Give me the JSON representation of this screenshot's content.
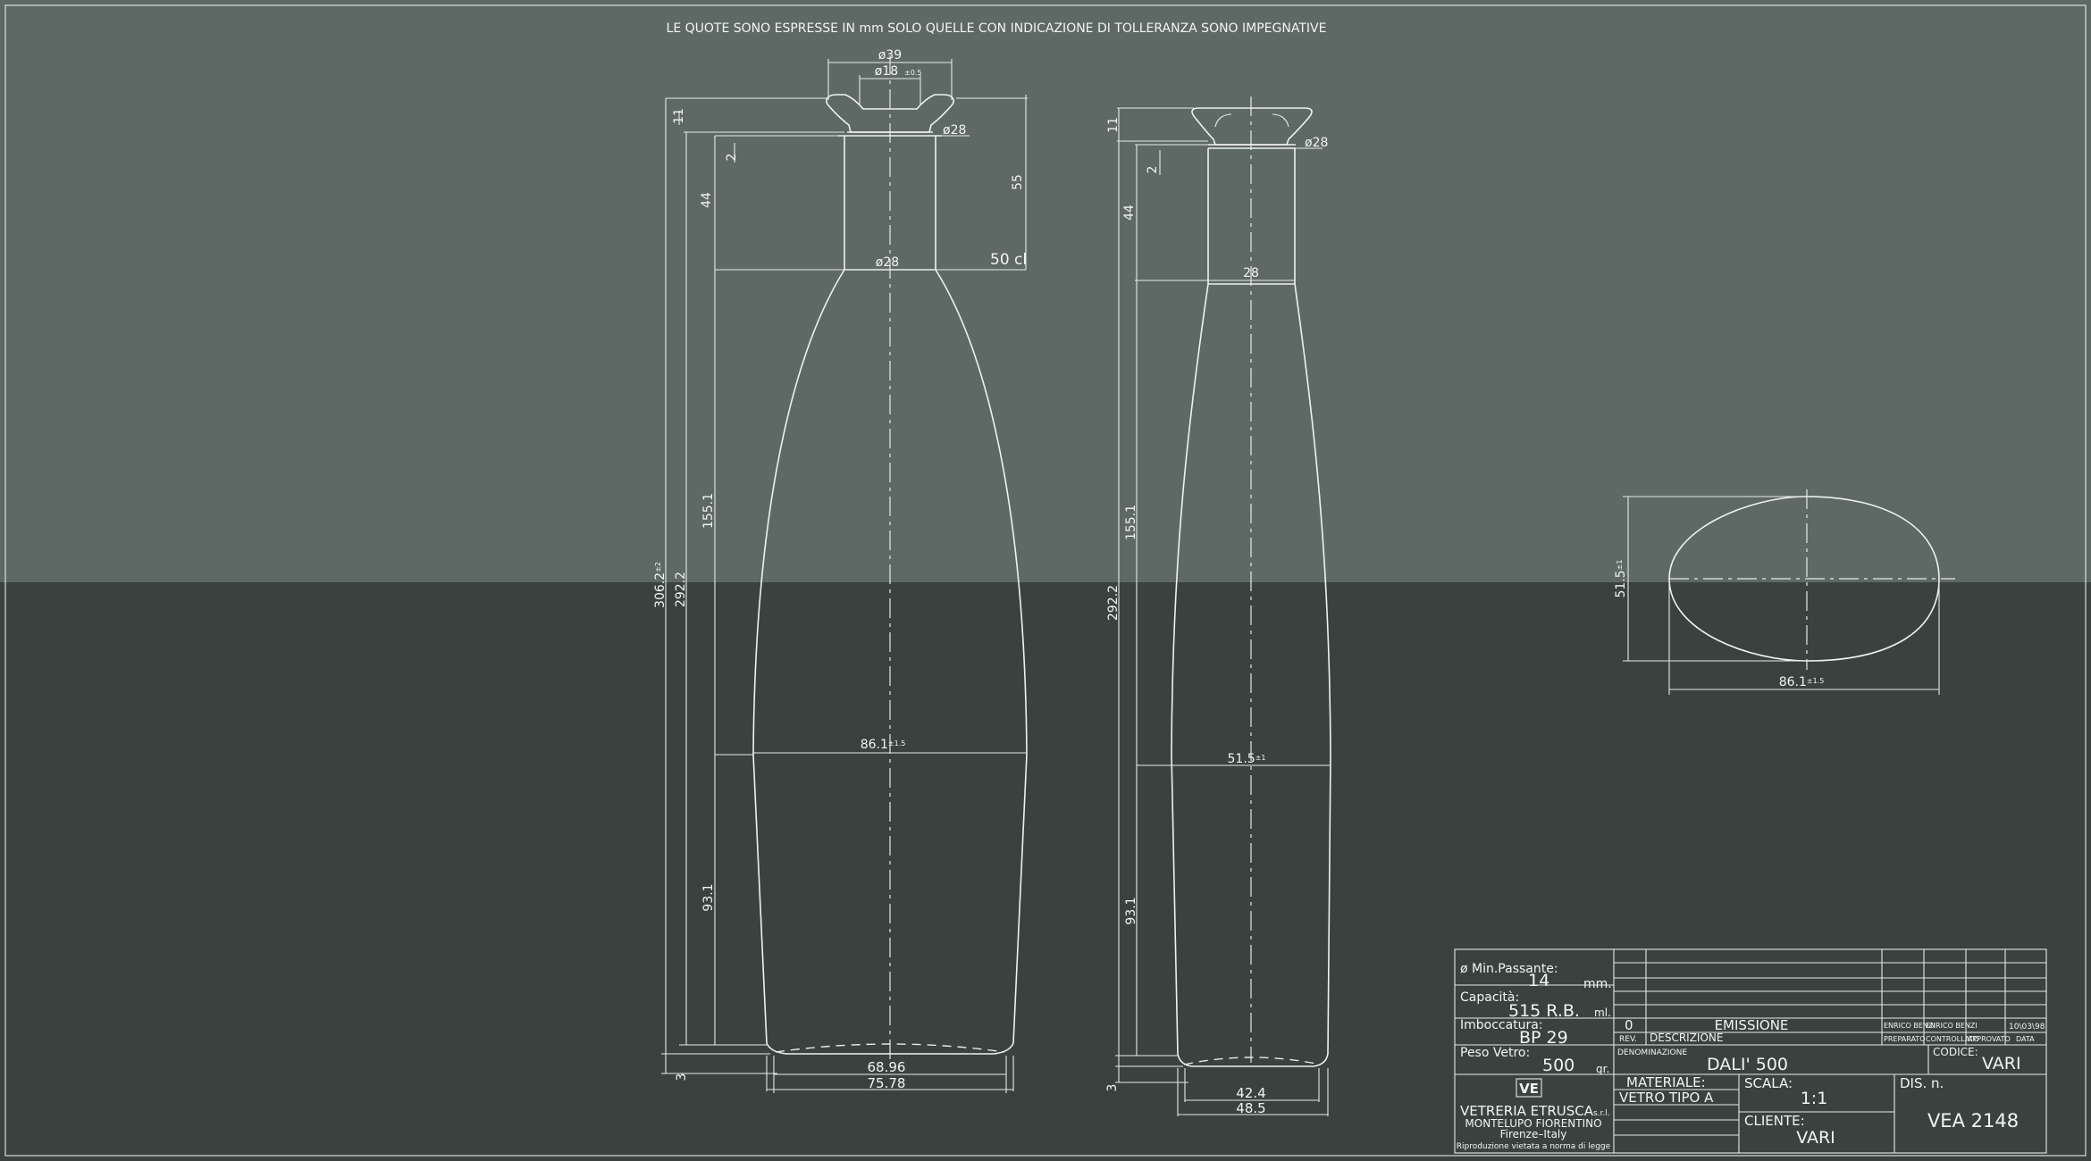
{
  "header": {
    "note": "LE QUOTE SONO ESPRESSE IN mm SOLO QUELLE CON INDICAZIONE DI TOLLERANZA SONO IMPEGNATIVE"
  },
  "front_view": {
    "top_diameter": "ø39",
    "neck_inner": "ø18",
    "neck_inner_tol": "±0.5",
    "neck_ring": "ø28",
    "shoulder_diameter": "ø28",
    "capacity_mark": "50 cl",
    "dim_11": "11",
    "dim_2": "2",
    "dim_44": "44",
    "dim_55": "55",
    "dim_306": "306.2",
    "dim_306_tol": "±2",
    "dim_292": "292.2",
    "dim_155": "155.1",
    "dim_93": "93.1",
    "dim_3": "3",
    "body_width": "86.1",
    "body_width_tol": "±1.5",
    "base_inner": "68.96",
    "base_outer": "75.78"
  },
  "side_view": {
    "neck_ring": "ø28",
    "neck_width": "28",
    "dim_11": "11",
    "dim_2": "2",
    "dim_44": "44",
    "dim_292": "292.2",
    "dim_155": "155.1",
    "dim_93": "93.1",
    "dim_3": "3",
    "body_width": "51.5",
    "body_width_tol": "±1",
    "base_inner": "42.4",
    "base_outer": "48.5"
  },
  "section_view": {
    "height": "51.5",
    "height_tol": "±1",
    "width": "86.1",
    "width_tol": "±1.5"
  },
  "title_block": {
    "min_passante_label": "ø  Min.Passante:",
    "min_passante_value": "14",
    "min_passante_unit": "mm.",
    "capacita_label": "Capacità:",
    "capacita_value": "515  R.B.",
    "capacita_unit": "ml.",
    "imboccatura_label": "Imboccatura:",
    "imboccatura_value": "BP  29",
    "peso_label": "Peso  Vetro:",
    "peso_value": "500",
    "peso_unit": "gr.",
    "rev_value": "0",
    "descr_value": "EMISSIONE",
    "prep_value": "ENRICO BENZI",
    "ctrl_value": "ENRICO BENZI",
    "date_value": "10\\03\\98",
    "rev_label": "REV.",
    "descr_label": "DESCRIZIONE",
    "prep_label": "PREPARATO",
    "ctrl_label": "CONTROLLATO",
    "appr_label": "APPROVATO",
    "date_label": "DATA",
    "denominazione_label": "DENOMINAZIONE",
    "denominazione_value": "DALI'  500",
    "codice_label": "CODICE:",
    "codice_value": "VARI",
    "logo_text": "VE",
    "company_name": "VETRERIA  ETRUSCA",
    "company_suffix": "s.r.l.",
    "company_city": "MONTELUPO  FIORENTINO",
    "company_region": "Firenze–Italy",
    "company_note": "Riproduzione  vietata  a  norma  di  legge",
    "materiale_label": "MATERIALE:",
    "materiale_value": "VETRO  TIPO  A",
    "scala_label": "SCALA:",
    "scala_value": "1:1",
    "cliente_label": "CLIENTE:",
    "cliente_value": "VARI",
    "dis_label": "DIS.  n.",
    "dis_value": "VEA  2148"
  }
}
